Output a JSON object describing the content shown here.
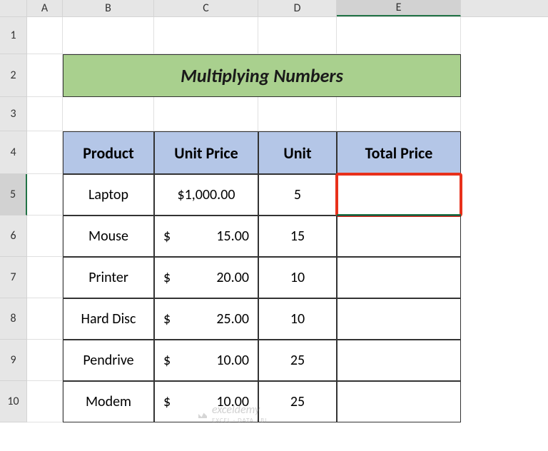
{
  "columns": [
    "A",
    "B",
    "C",
    "D",
    "E"
  ],
  "rows": [
    "1",
    "2",
    "3",
    "4",
    "5",
    "6",
    "7",
    "8",
    "9",
    "10"
  ],
  "selected_column": "E",
  "selected_row": "5",
  "title": "Multiplying Numbers",
  "table": {
    "headers": [
      "Product",
      "Unit Price",
      "Unit",
      "Total Price"
    ],
    "rows": [
      {
        "product": "Laptop",
        "price_sym": "$",
        "price_amt": "1,000.00",
        "price_display": "$1,000.00",
        "unit": "5",
        "total": ""
      },
      {
        "product": "Mouse",
        "price_sym": "$",
        "price_amt": "15.00",
        "price_display": "$   15.00",
        "unit": "15",
        "total": ""
      },
      {
        "product": "Printer",
        "price_sym": "$",
        "price_amt": "20.00",
        "price_display": "$   20.00",
        "unit": "10",
        "total": ""
      },
      {
        "product": "Hard Disc",
        "price_sym": "$",
        "price_amt": "25.00",
        "price_display": "$   25.00",
        "unit": "10",
        "total": ""
      },
      {
        "product": "Pendrive",
        "price_sym": "$",
        "price_amt": "10.00",
        "price_display": "$   10.00",
        "unit": "25",
        "total": ""
      },
      {
        "product": "Modem",
        "price_sym": "$",
        "price_amt": "10.00",
        "price_display": "$   10.00",
        "unit": "25",
        "total": ""
      }
    ]
  },
  "watermark": {
    "brand": "exceldemy",
    "tagline": "EXCEL · DATA · BI"
  },
  "chart_data": {
    "type": "table",
    "title": "Multiplying Numbers",
    "columns": [
      "Product",
      "Unit Price",
      "Unit",
      "Total Price"
    ],
    "rows": [
      [
        "Laptop",
        1000.0,
        5,
        null
      ],
      [
        "Mouse",
        15.0,
        15,
        null
      ],
      [
        "Printer",
        20.0,
        10,
        null
      ],
      [
        "Hard Disc",
        25.0,
        10,
        null
      ],
      [
        "Pendrive",
        10.0,
        25,
        null
      ],
      [
        "Modem",
        10.0,
        25,
        null
      ]
    ]
  }
}
